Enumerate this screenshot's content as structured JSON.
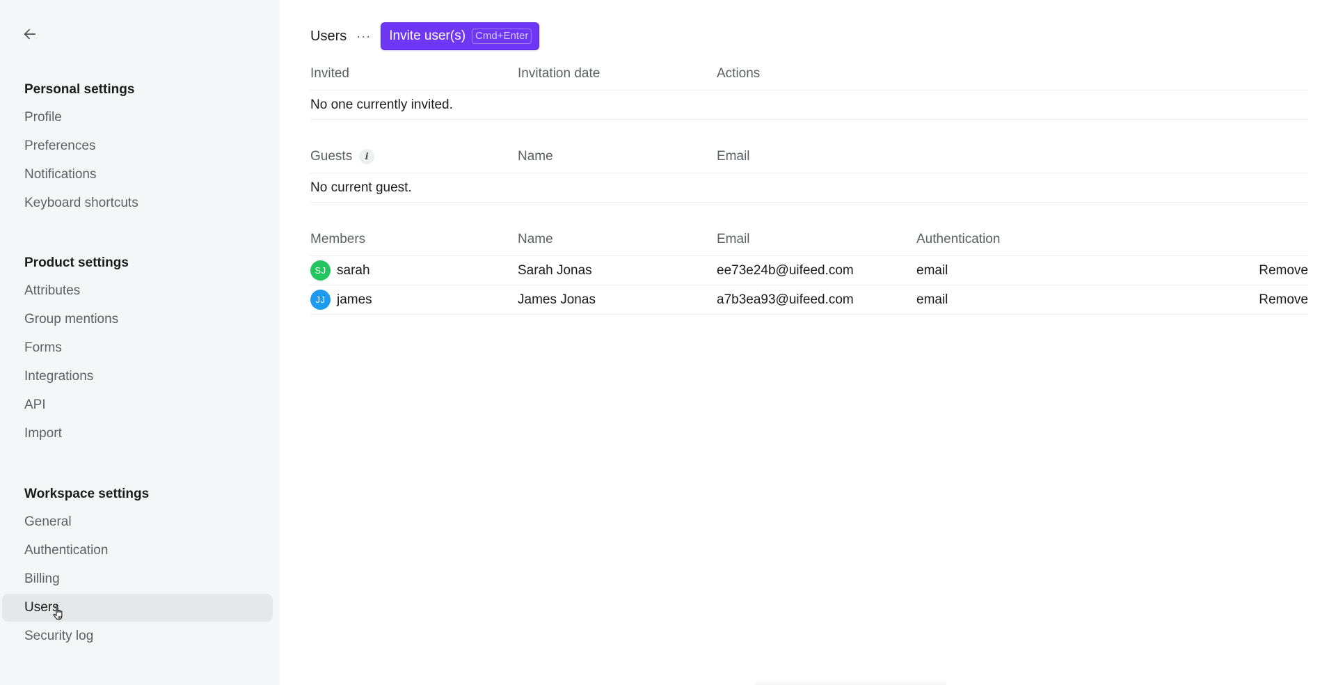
{
  "sidebar": {
    "back_icon": "arrow-left-icon",
    "sections": [
      {
        "heading": "Personal settings",
        "items": [
          "Profile",
          "Preferences",
          "Notifications",
          "Keyboard shortcuts"
        ]
      },
      {
        "heading": "Product settings",
        "items": [
          "Attributes",
          "Group mentions",
          "Forms",
          "Integrations",
          "API",
          "Import"
        ]
      },
      {
        "heading": "Workspace settings",
        "items": [
          "General",
          "Authentication",
          "Billing",
          "Users",
          "Security log"
        ],
        "active": "Users"
      }
    ]
  },
  "header": {
    "title": "Users",
    "more_label": "···",
    "invite_label": "Invite user(s)",
    "invite_shortcut": "Cmd+Enter",
    "accent_color": "#6e37f5"
  },
  "invited": {
    "columns": [
      "Invited",
      "Invitation date",
      "Actions"
    ],
    "empty_text": "No one currently invited."
  },
  "guests": {
    "columns": [
      "Guests",
      "Name",
      "Email"
    ],
    "empty_text": "No current guest."
  },
  "members": {
    "columns": [
      "Members",
      "Name",
      "Email",
      "Authentication"
    ],
    "rows": [
      {
        "initials": "SJ",
        "avatar_color": "#22c55e",
        "username": "sarah",
        "name": "Sarah Jonas",
        "email": "ee73e24b@uifeed.com",
        "auth": "email",
        "action": "Remove"
      },
      {
        "initials": "JJ",
        "avatar_color": "#1d9bf0",
        "username": "james",
        "name": "James Jonas",
        "email": "a7b3ea93@uifeed.com",
        "auth": "email",
        "action": "Remove"
      }
    ]
  }
}
